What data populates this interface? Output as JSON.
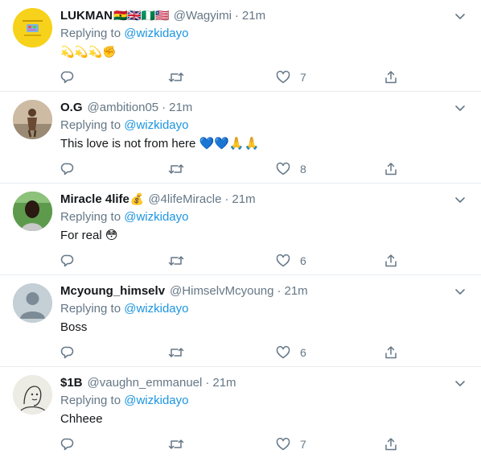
{
  "replying_label": "Replying to",
  "tweets": [
    {
      "name": "LUKMAN",
      "name_suffix": "🇬🇭🇬🇧🇳🇬🇱🇷",
      "handle": "@Wagyimi",
      "time": "21m",
      "reply_to": "@wizkidayo",
      "text": "💫💫💫✊",
      "replies": "",
      "retweets": "",
      "likes": "7",
      "avatar": "lukman-logo",
      "avatar_color": "#f5d000"
    },
    {
      "name": "O.G",
      "name_suffix": "",
      "handle": "@ambition05",
      "time": "21m",
      "reply_to": "@wizkidayo",
      "text": "This love is not from here 💙💙🙏🙏",
      "replies": "",
      "retweets": "",
      "likes": "8",
      "avatar": "photo",
      "avatar_color": "#b08a6a"
    },
    {
      "name": "Miracle 4life",
      "name_suffix": "💰",
      "handle": "@4lifeMiracle",
      "time": "21m",
      "reply_to": "@wizkidayo",
      "text": "For real 😳",
      "replies": "",
      "retweets": "",
      "likes": "6",
      "avatar": "photo",
      "avatar_color": "#3f7f3a"
    },
    {
      "name": "Mcyoung_himselv",
      "name_suffix": "",
      "handle": "@HimselvMcyoung",
      "time": "21m",
      "reply_to": "@wizkidayo",
      "text": "Boss",
      "replies": "",
      "retweets": "",
      "likes": "6",
      "avatar": "default-user",
      "avatar_color": "#c4cfd6"
    },
    {
      "name": "$1B",
      "name_suffix": "",
      "handle": "@vaughn_emmanuel",
      "time": "21m",
      "reply_to": "@wizkidayo",
      "text": "Chheee",
      "replies": "",
      "retweets": "",
      "likes": "7",
      "avatar": "sketch",
      "avatar_color": "#e8e8e0"
    }
  ],
  "colors": {
    "link": "#1b95e0",
    "muted": "#657786",
    "border": "#e6ecf0"
  },
  "icons": [
    "chevron-down-icon",
    "reply-icon",
    "retweet-icon",
    "like-icon",
    "share-icon"
  ]
}
